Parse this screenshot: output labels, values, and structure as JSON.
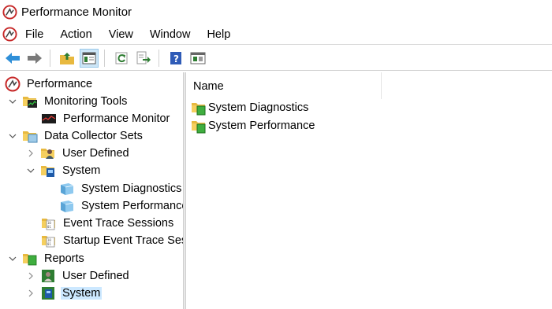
{
  "window": {
    "title": "Performance Monitor"
  },
  "menu": [
    "File",
    "Action",
    "View",
    "Window",
    "Help"
  ],
  "toolbar": {
    "buttons": [
      "back-arrow-icon",
      "forward-arrow-icon",
      "up-folder-icon",
      "show-hide-tree-icon",
      "refresh-icon",
      "export-list-icon",
      "help-icon",
      "properties-icon"
    ],
    "active": "show-hide-tree-icon"
  },
  "tree": {
    "root": "Performance",
    "items": [
      {
        "label": "Monitoring Tools",
        "expanded": true
      },
      {
        "label": "Performance Monitor"
      },
      {
        "label": "Data Collector Sets",
        "expanded": true
      },
      {
        "label": "User Defined",
        "expanded": false
      },
      {
        "label": "System",
        "expanded": true
      },
      {
        "label": "System Diagnostics"
      },
      {
        "label": "System Performance"
      },
      {
        "label": "Event Trace Sessions"
      },
      {
        "label": "Startup Event Trace Sess"
      },
      {
        "label": "Reports",
        "expanded": true
      },
      {
        "label": "User Defined",
        "expanded": false
      },
      {
        "label": "System",
        "expanded": false,
        "selected": true
      }
    ]
  },
  "list": {
    "column_header": "Name",
    "rows": [
      "System Diagnostics",
      "System Performance"
    ]
  },
  "colors": {
    "selection": "#cce8ff",
    "toolbar_active": "#cde6f7",
    "folder": "#f2c94c",
    "accent_green": "#4caf50"
  }
}
